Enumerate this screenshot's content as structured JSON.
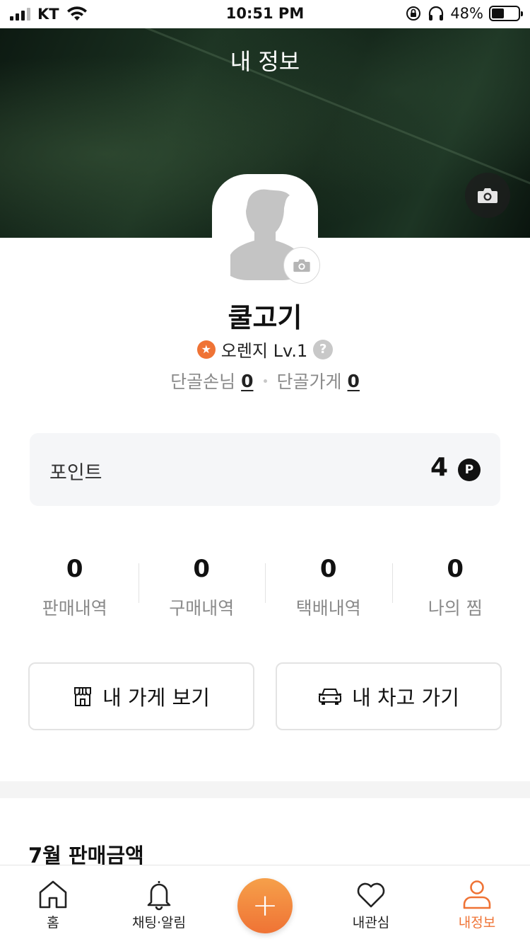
{
  "status_bar": {
    "carrier": "KT",
    "time": "10:51 PM",
    "battery_pct_text": "48%",
    "battery_level": 0.48
  },
  "header": {
    "title": "내 정보"
  },
  "profile": {
    "nickname": "쿨고기",
    "level_text": "오렌지 Lv.1",
    "help_glyph": "?",
    "regular_customers_label": "단골손님",
    "regular_customers_count": "0",
    "regular_stores_label": "단골가게",
    "regular_stores_count": "0"
  },
  "points": {
    "label": "포인트",
    "value": "4",
    "icon_glyph": "P"
  },
  "stats": [
    {
      "value": "0",
      "label": "판매내역"
    },
    {
      "value": "0",
      "label": "구매내역"
    },
    {
      "value": "0",
      "label": "택배내역"
    },
    {
      "value": "0",
      "label": "나의 찜"
    }
  ],
  "buttons": {
    "my_store": "내 가게 보기",
    "my_garage": "내 차고 가기"
  },
  "sales": {
    "title": "7월 판매금액"
  },
  "tabbar": {
    "items": [
      {
        "label": "홈",
        "icon": "home-icon"
      },
      {
        "label": "채팅·알림",
        "icon": "bell-icon"
      },
      {
        "label": "내관심",
        "icon": "heart-icon"
      },
      {
        "label": "내정보",
        "icon": "person-icon"
      }
    ],
    "fab_glyph": "+"
  },
  "colors": {
    "accent": "#ef7335",
    "text": "#111111",
    "muted": "#8a8a8a"
  }
}
